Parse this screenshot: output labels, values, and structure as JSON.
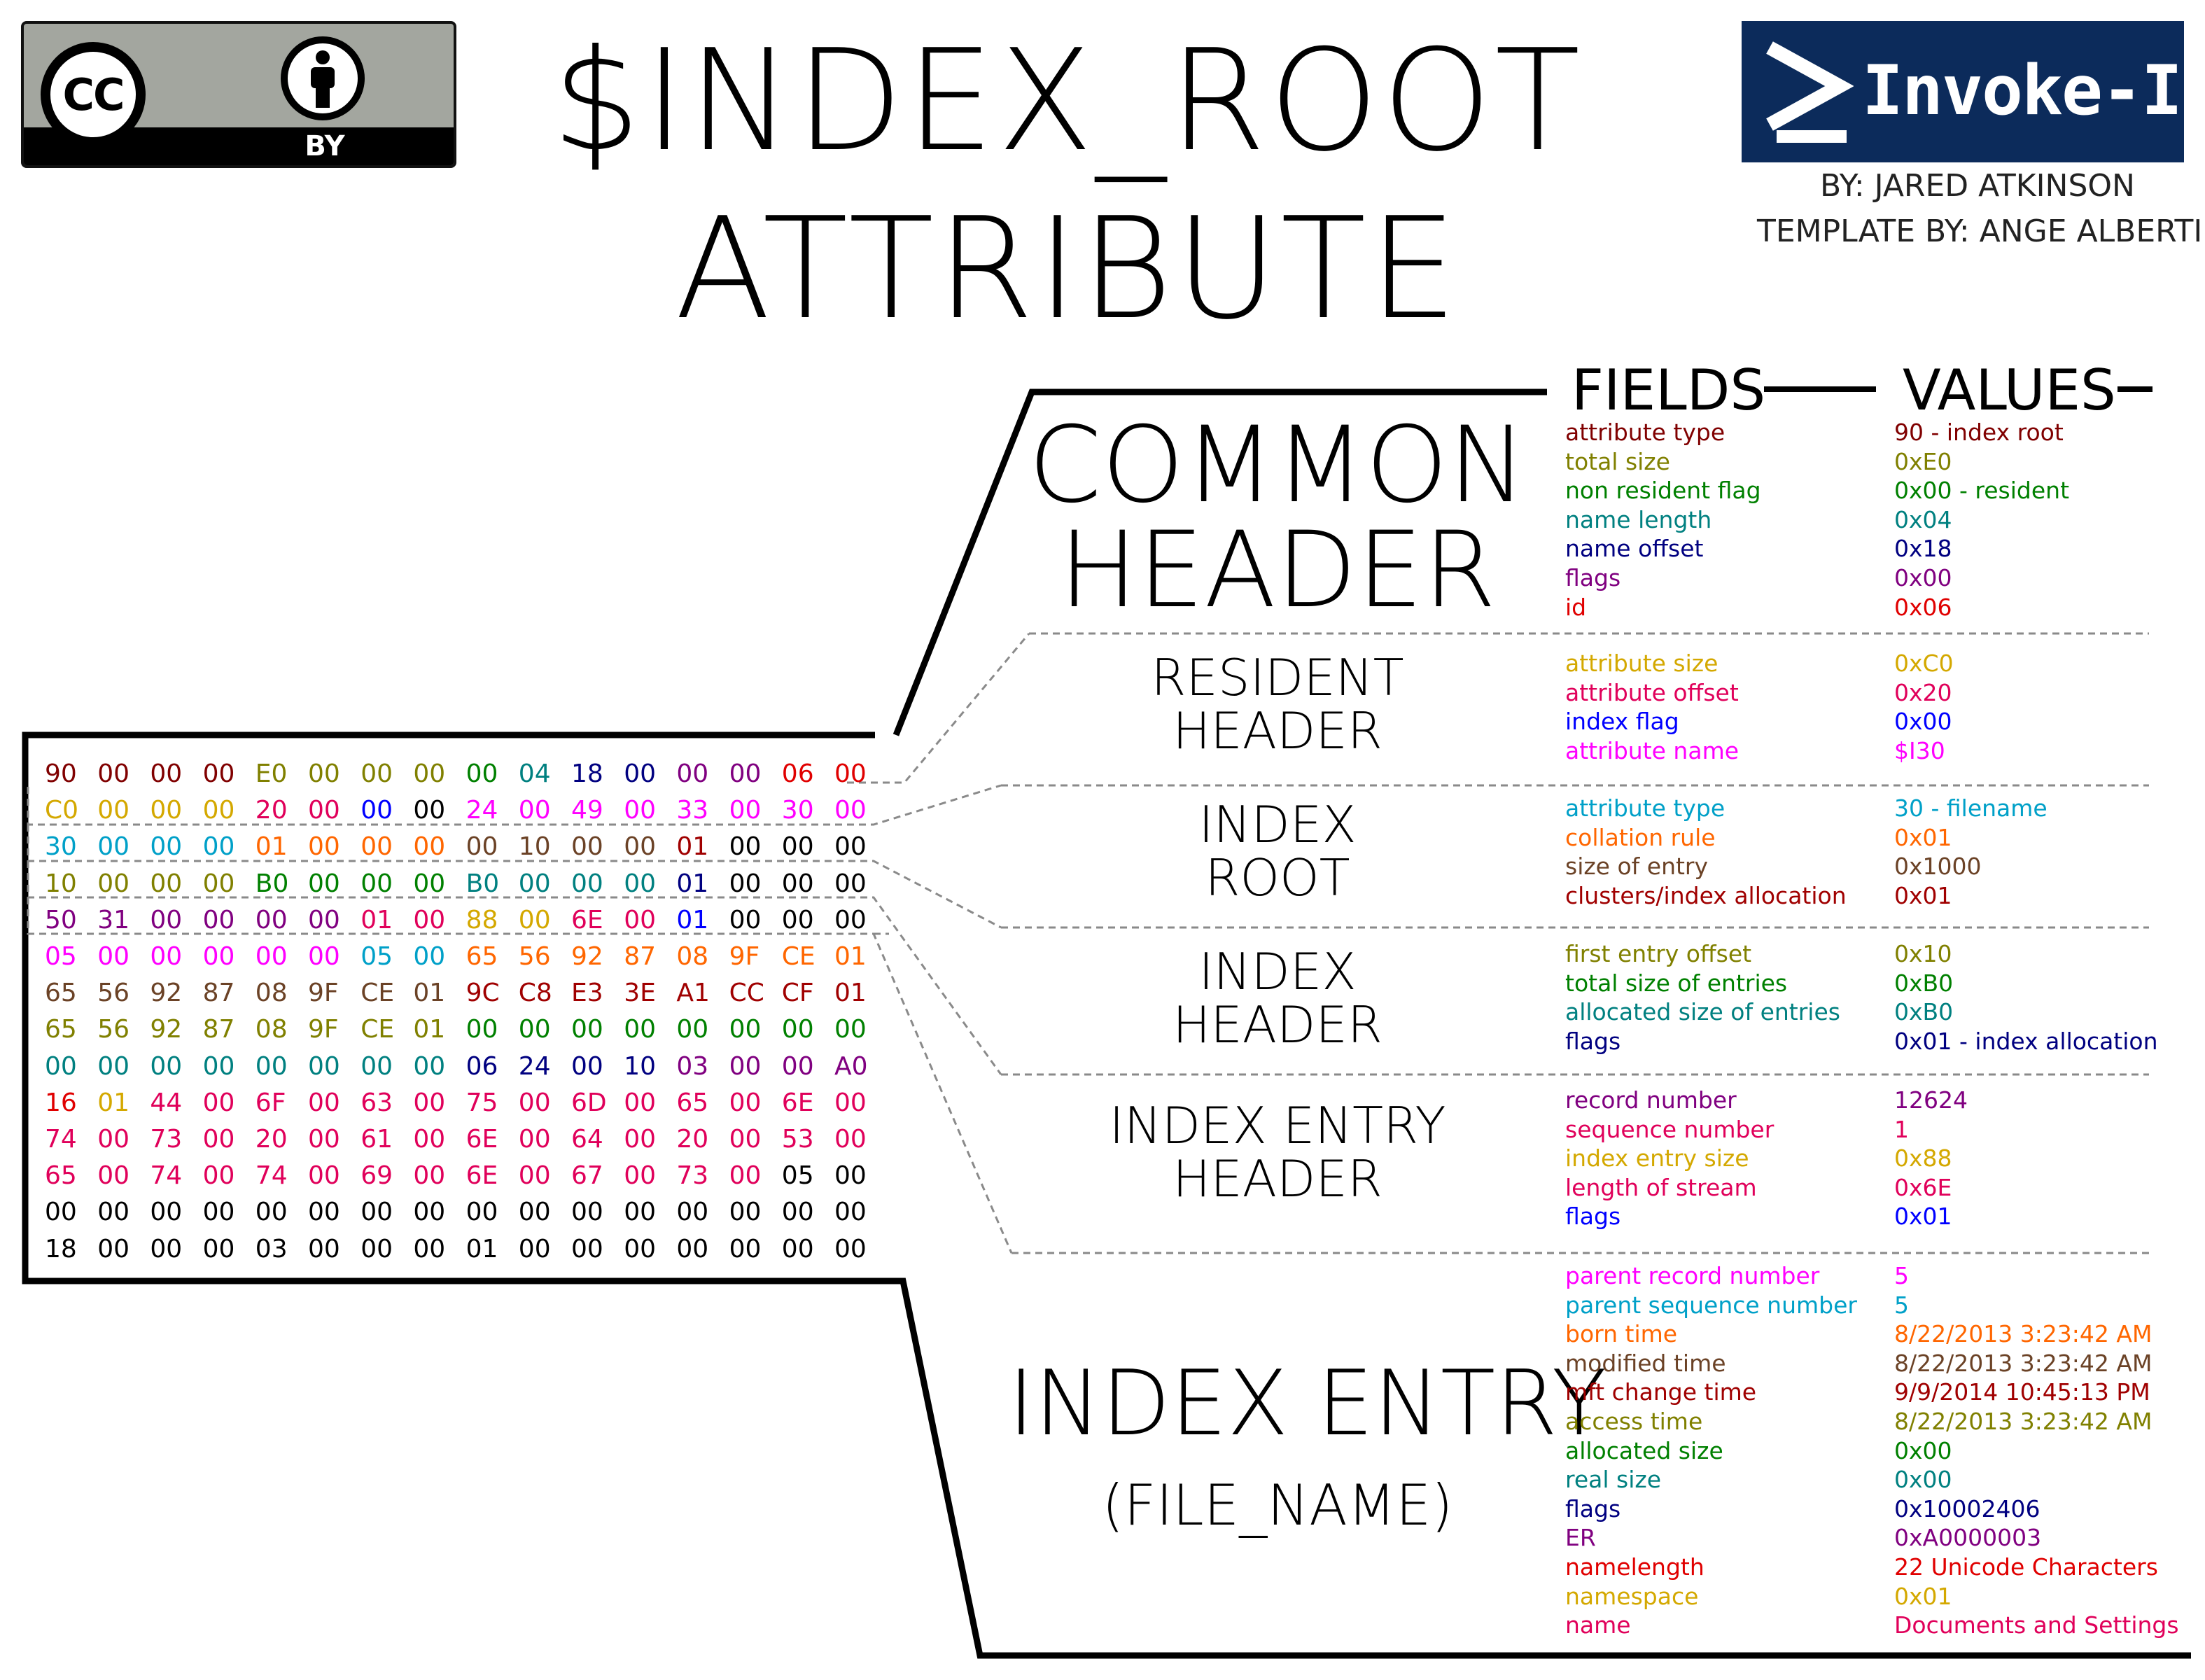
{
  "license_badge": {
    "cc_text": "CC",
    "by_text": "BY"
  },
  "title": {
    "line1": "$INDEX_ROOT",
    "line2": "ATTRIBUTE"
  },
  "logo": {
    "text": "Invoke-IR",
    "prompt_icon": "powershell-prompt-icon",
    "background": "#0c2b5b"
  },
  "credits": {
    "author": "BY: JARED ATKINSON",
    "template": "TEMPLATE BY: ANGE ALBERTINI"
  },
  "columns": {
    "fields": "FIELDS",
    "values": "VALUES"
  },
  "colors": {
    "maroon": "#800000",
    "olive": "#808000",
    "green": "#008000",
    "teal": "#008080",
    "navy": "#000080",
    "purple": "#800080",
    "red": "#e00000",
    "gold": "#d4a800",
    "crimson": "#e0005a",
    "blue": "#0000ff",
    "magenta": "#ff00ff",
    "cyan": "#00a0c8",
    "orange": "#ff6600",
    "brown": "#6b4226",
    "darkred": "#a00000",
    "black": "#000000"
  },
  "hex_rows": [
    [
      [
        "90",
        "maroon"
      ],
      [
        "00",
        "maroon"
      ],
      [
        "00",
        "maroon"
      ],
      [
        "00",
        "maroon"
      ],
      [
        "E0",
        "olive"
      ],
      [
        "00",
        "olive"
      ],
      [
        "00",
        "olive"
      ],
      [
        "00",
        "olive"
      ],
      [
        "00",
        "green"
      ],
      [
        "04",
        "teal"
      ],
      [
        "18",
        "navy"
      ],
      [
        "00",
        "navy"
      ],
      [
        "00",
        "purple"
      ],
      [
        "00",
        "purple"
      ],
      [
        "06",
        "red"
      ],
      [
        "00",
        "red"
      ]
    ],
    [
      [
        "C0",
        "gold"
      ],
      [
        "00",
        "gold"
      ],
      [
        "00",
        "gold"
      ],
      [
        "00",
        "gold"
      ],
      [
        "20",
        "crimson"
      ],
      [
        "00",
        "crimson"
      ],
      [
        "00",
        "blue"
      ],
      [
        "00",
        "black"
      ],
      [
        "24",
        "magenta"
      ],
      [
        "00",
        "magenta"
      ],
      [
        "49",
        "magenta"
      ],
      [
        "00",
        "magenta"
      ],
      [
        "33",
        "magenta"
      ],
      [
        "00",
        "magenta"
      ],
      [
        "30",
        "magenta"
      ],
      [
        "00",
        "magenta"
      ]
    ],
    [
      [
        "30",
        "cyan"
      ],
      [
        "00",
        "cyan"
      ],
      [
        "00",
        "cyan"
      ],
      [
        "00",
        "cyan"
      ],
      [
        "01",
        "orange"
      ],
      [
        "00",
        "orange"
      ],
      [
        "00",
        "orange"
      ],
      [
        "00",
        "orange"
      ],
      [
        "00",
        "brown"
      ],
      [
        "10",
        "brown"
      ],
      [
        "00",
        "brown"
      ],
      [
        "00",
        "brown"
      ],
      [
        "01",
        "darkred"
      ],
      [
        "00",
        "black"
      ],
      [
        "00",
        "black"
      ],
      [
        "00",
        "black"
      ]
    ],
    [
      [
        "10",
        "olive"
      ],
      [
        "00",
        "olive"
      ],
      [
        "00",
        "olive"
      ],
      [
        "00",
        "olive"
      ],
      [
        "B0",
        "green"
      ],
      [
        "00",
        "green"
      ],
      [
        "00",
        "green"
      ],
      [
        "00",
        "green"
      ],
      [
        "B0",
        "teal"
      ],
      [
        "00",
        "teal"
      ],
      [
        "00",
        "teal"
      ],
      [
        "00",
        "teal"
      ],
      [
        "01",
        "navy"
      ],
      [
        "00",
        "black"
      ],
      [
        "00",
        "black"
      ],
      [
        "00",
        "black"
      ]
    ],
    [
      [
        "50",
        "purple"
      ],
      [
        "31",
        "purple"
      ],
      [
        "00",
        "purple"
      ],
      [
        "00",
        "purple"
      ],
      [
        "00",
        "purple"
      ],
      [
        "00",
        "purple"
      ],
      [
        "01",
        "crimson"
      ],
      [
        "00",
        "crimson"
      ],
      [
        "88",
        "gold"
      ],
      [
        "00",
        "gold"
      ],
      [
        "6E",
        "crimson"
      ],
      [
        "00",
        "crimson"
      ],
      [
        "01",
        "blue"
      ],
      [
        "00",
        "black"
      ],
      [
        "00",
        "black"
      ],
      [
        "00",
        "black"
      ]
    ],
    [
      [
        "05",
        "magenta"
      ],
      [
        "00",
        "magenta"
      ],
      [
        "00",
        "magenta"
      ],
      [
        "00",
        "magenta"
      ],
      [
        "00",
        "magenta"
      ],
      [
        "00",
        "magenta"
      ],
      [
        "05",
        "cyan"
      ],
      [
        "00",
        "cyan"
      ],
      [
        "65",
        "orange"
      ],
      [
        "56",
        "orange"
      ],
      [
        "92",
        "orange"
      ],
      [
        "87",
        "orange"
      ],
      [
        "08",
        "orange"
      ],
      [
        "9F",
        "orange"
      ],
      [
        "CE",
        "orange"
      ],
      [
        "01",
        "orange"
      ]
    ],
    [
      [
        "65",
        "brown"
      ],
      [
        "56",
        "brown"
      ],
      [
        "92",
        "brown"
      ],
      [
        "87",
        "brown"
      ],
      [
        "08",
        "brown"
      ],
      [
        "9F",
        "brown"
      ],
      [
        "CE",
        "brown"
      ],
      [
        "01",
        "brown"
      ],
      [
        "9C",
        "darkred"
      ],
      [
        "C8",
        "darkred"
      ],
      [
        "E3",
        "darkred"
      ],
      [
        "3E",
        "darkred"
      ],
      [
        "A1",
        "darkred"
      ],
      [
        "CC",
        "darkred"
      ],
      [
        "CF",
        "darkred"
      ],
      [
        "01",
        "darkred"
      ]
    ],
    [
      [
        "65",
        "olive"
      ],
      [
        "56",
        "olive"
      ],
      [
        "92",
        "olive"
      ],
      [
        "87",
        "olive"
      ],
      [
        "08",
        "olive"
      ],
      [
        "9F",
        "olive"
      ],
      [
        "CE",
        "olive"
      ],
      [
        "01",
        "olive"
      ],
      [
        "00",
        "green"
      ],
      [
        "00",
        "green"
      ],
      [
        "00",
        "green"
      ],
      [
        "00",
        "green"
      ],
      [
        "00",
        "green"
      ],
      [
        "00",
        "green"
      ],
      [
        "00",
        "green"
      ],
      [
        "00",
        "green"
      ]
    ],
    [
      [
        "00",
        "teal"
      ],
      [
        "00",
        "teal"
      ],
      [
        "00",
        "teal"
      ],
      [
        "00",
        "teal"
      ],
      [
        "00",
        "teal"
      ],
      [
        "00",
        "teal"
      ],
      [
        "00",
        "teal"
      ],
      [
        "00",
        "teal"
      ],
      [
        "06",
        "navy"
      ],
      [
        "24",
        "navy"
      ],
      [
        "00",
        "navy"
      ],
      [
        "10",
        "navy"
      ],
      [
        "03",
        "purple"
      ],
      [
        "00",
        "purple"
      ],
      [
        "00",
        "purple"
      ],
      [
        "A0",
        "purple"
      ]
    ],
    [
      [
        "16",
        "red"
      ],
      [
        "01",
        "gold"
      ],
      [
        "44",
        "crimson"
      ],
      [
        "00",
        "crimson"
      ],
      [
        "6F",
        "crimson"
      ],
      [
        "00",
        "crimson"
      ],
      [
        "63",
        "crimson"
      ],
      [
        "00",
        "crimson"
      ],
      [
        "75",
        "crimson"
      ],
      [
        "00",
        "crimson"
      ],
      [
        "6D",
        "crimson"
      ],
      [
        "00",
        "crimson"
      ],
      [
        "65",
        "crimson"
      ],
      [
        "00",
        "crimson"
      ],
      [
        "6E",
        "crimson"
      ],
      [
        "00",
        "crimson"
      ]
    ],
    [
      [
        "74",
        "crimson"
      ],
      [
        "00",
        "crimson"
      ],
      [
        "73",
        "crimson"
      ],
      [
        "00",
        "crimson"
      ],
      [
        "20",
        "crimson"
      ],
      [
        "00",
        "crimson"
      ],
      [
        "61",
        "crimson"
      ],
      [
        "00",
        "crimson"
      ],
      [
        "6E",
        "crimson"
      ],
      [
        "00",
        "crimson"
      ],
      [
        "64",
        "crimson"
      ],
      [
        "00",
        "crimson"
      ],
      [
        "20",
        "crimson"
      ],
      [
        "00",
        "crimson"
      ],
      [
        "53",
        "crimson"
      ],
      [
        "00",
        "crimson"
      ]
    ],
    [
      [
        "65",
        "crimson"
      ],
      [
        "00",
        "crimson"
      ],
      [
        "74",
        "crimson"
      ],
      [
        "00",
        "crimson"
      ],
      [
        "74",
        "crimson"
      ],
      [
        "00",
        "crimson"
      ],
      [
        "69",
        "crimson"
      ],
      [
        "00",
        "crimson"
      ],
      [
        "6E",
        "crimson"
      ],
      [
        "00",
        "crimson"
      ],
      [
        "67",
        "crimson"
      ],
      [
        "00",
        "crimson"
      ],
      [
        "73",
        "crimson"
      ],
      [
        "00",
        "crimson"
      ],
      [
        "05",
        "black"
      ],
      [
        "00",
        "black"
      ]
    ],
    [
      [
        "00",
        "black"
      ],
      [
        "00",
        "black"
      ],
      [
        "00",
        "black"
      ],
      [
        "00",
        "black"
      ],
      [
        "00",
        "black"
      ],
      [
        "00",
        "black"
      ],
      [
        "00",
        "black"
      ],
      [
        "00",
        "black"
      ],
      [
        "00",
        "black"
      ],
      [
        "00",
        "black"
      ],
      [
        "00",
        "black"
      ],
      [
        "00",
        "black"
      ],
      [
        "00",
        "black"
      ],
      [
        "00",
        "black"
      ],
      [
        "00",
        "black"
      ],
      [
        "00",
        "black"
      ]
    ],
    [
      [
        "18",
        "black"
      ],
      [
        "00",
        "black"
      ],
      [
        "00",
        "black"
      ],
      [
        "00",
        "black"
      ],
      [
        "03",
        "black"
      ],
      [
        "00",
        "black"
      ],
      [
        "00",
        "black"
      ],
      [
        "00",
        "black"
      ],
      [
        "01",
        "black"
      ],
      [
        "00",
        "black"
      ],
      [
        "00",
        "black"
      ],
      [
        "00",
        "black"
      ],
      [
        "00",
        "black"
      ],
      [
        "00",
        "black"
      ],
      [
        "00",
        "black"
      ],
      [
        "00",
        "black"
      ]
    ]
  ],
  "sections": [
    {
      "key": "common-header",
      "name": [
        "COMMON",
        "HEADER"
      ],
      "fields": [
        {
          "field": "attribute type",
          "value": "90 - index root",
          "color": "maroon"
        },
        {
          "field": "total size",
          "value": "0xE0",
          "color": "olive"
        },
        {
          "field": "non resident flag",
          "value": "0x00 - resident",
          "color": "green"
        },
        {
          "field": "name length",
          "value": "0x04",
          "color": "teal"
        },
        {
          "field": "name offset",
          "value": "0x18",
          "color": "navy"
        },
        {
          "field": "flags",
          "value": "0x00",
          "color": "purple"
        },
        {
          "field": "id",
          "value": "0x06",
          "color": "red"
        }
      ]
    },
    {
      "key": "resident-header",
      "name": [
        "RESIDENT",
        "HEADER"
      ],
      "fields": [
        {
          "field": "attribute size",
          "value": "0xC0",
          "color": "gold"
        },
        {
          "field": "attribute offset",
          "value": "0x20",
          "color": "crimson"
        },
        {
          "field": "index flag",
          "value": "0x00",
          "color": "blue"
        },
        {
          "field": "attribute name",
          "value": "$I30",
          "color": "magenta"
        }
      ]
    },
    {
      "key": "index-root",
      "name": [
        "INDEX",
        "ROOT"
      ],
      "fields": [
        {
          "field": "attribute type",
          "value": "30 - filename",
          "color": "cyan"
        },
        {
          "field": "collation rule",
          "value": "0x01",
          "color": "orange"
        },
        {
          "field": "size of entry",
          "value": "0x1000",
          "color": "brown"
        },
        {
          "field": "clusters/index allocation",
          "value": "0x01",
          "color": "darkred"
        }
      ]
    },
    {
      "key": "index-header",
      "name": [
        "INDEX",
        "HEADER"
      ],
      "fields": [
        {
          "field": "first entry offset",
          "value": "0x10",
          "color": "olive"
        },
        {
          "field": "total size of entries",
          "value": "0xB0",
          "color": "green"
        },
        {
          "field": "allocated size of entries",
          "value": "0xB0",
          "color": "teal"
        },
        {
          "field": "flags",
          "value": "0x01 - index allocation",
          "color": "navy"
        }
      ]
    },
    {
      "key": "index-entry-header",
      "name": [
        "INDEX ENTRY",
        "HEADER"
      ],
      "fields": [
        {
          "field": "record number",
          "value": "12624",
          "color": "purple"
        },
        {
          "field": "sequence number",
          "value": "1",
          "color": "crimson"
        },
        {
          "field": "index entry size",
          "value": "0x88",
          "color": "gold"
        },
        {
          "field": "length of stream",
          "value": "0x6E",
          "color": "crimson"
        },
        {
          "field": "flags",
          "value": "0x01",
          "color": "blue"
        }
      ]
    },
    {
      "key": "index-entry-file-name",
      "name": [
        "INDEX ENTRY",
        "(FILE_NAME)"
      ],
      "fields": [
        {
          "field": "parent record number",
          "value": "5",
          "color": "magenta"
        },
        {
          "field": "parent sequence number",
          "value": "5",
          "color": "cyan"
        },
        {
          "field": "born time",
          "value": "8/22/2013 3:23:42 AM",
          "color": "orange"
        },
        {
          "field": "modified time",
          "value": "8/22/2013 3:23:42 AM",
          "color": "brown"
        },
        {
          "field": "mft change time",
          "value": "9/9/2014 10:45:13 PM",
          "color": "darkred"
        },
        {
          "field": "access time",
          "value": "8/22/2013 3:23:42 AM",
          "color": "olive"
        },
        {
          "field": "allocated size",
          "value": "0x00",
          "color": "green"
        },
        {
          "field": "real size",
          "value": "0x00",
          "color": "teal"
        },
        {
          "field": "flags",
          "value": "0x10002406",
          "color": "navy"
        },
        {
          "field": "ER",
          "value": "0xA0000003",
          "color": "purple"
        },
        {
          "field": "namelength",
          "value": "22 Unicode Characters",
          "color": "red"
        },
        {
          "field": "namespace",
          "value": "0x01",
          "color": "gold"
        },
        {
          "field": "name",
          "value": "Documents and Settings",
          "color": "crimson"
        }
      ]
    }
  ]
}
